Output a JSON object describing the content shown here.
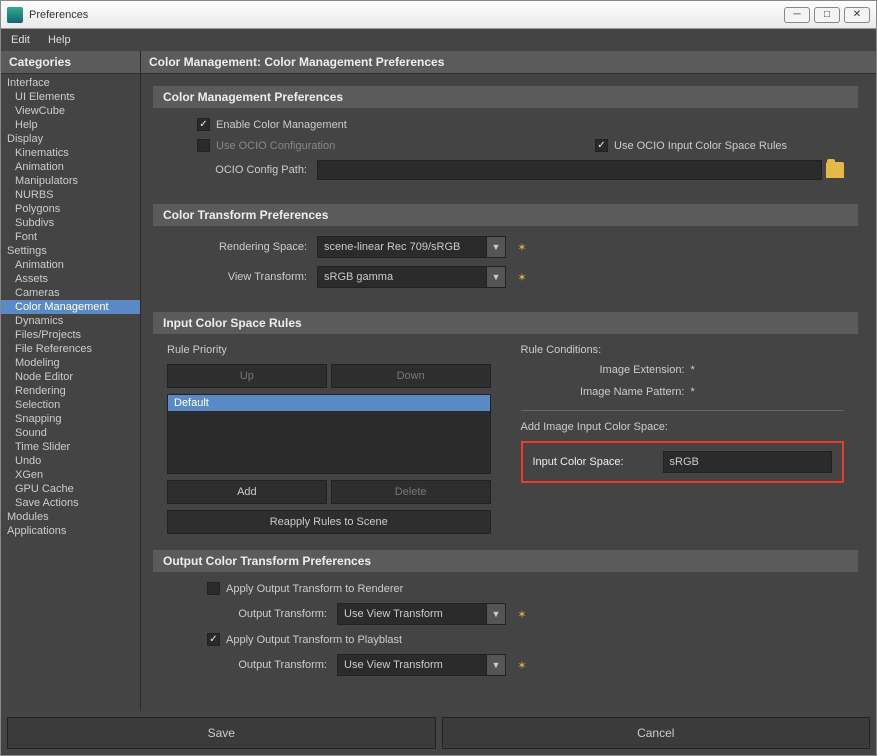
{
  "window": {
    "title": "Preferences"
  },
  "menu": {
    "edit": "Edit",
    "help": "Help"
  },
  "sidebar": {
    "header": "Categories",
    "items": [
      {
        "label": "Interface",
        "top": true
      },
      {
        "label": "UI Elements"
      },
      {
        "label": "ViewCube"
      },
      {
        "label": "Help"
      },
      {
        "label": "Display",
        "top": true
      },
      {
        "label": "Kinematics"
      },
      {
        "label": "Animation"
      },
      {
        "label": "Manipulators"
      },
      {
        "label": "NURBS"
      },
      {
        "label": "Polygons"
      },
      {
        "label": "Subdivs"
      },
      {
        "label": "Font"
      },
      {
        "label": "Settings",
        "top": true
      },
      {
        "label": "Animation"
      },
      {
        "label": "Assets"
      },
      {
        "label": "Cameras"
      },
      {
        "label": "Color Management",
        "selected": true
      },
      {
        "label": "Dynamics"
      },
      {
        "label": "Files/Projects"
      },
      {
        "label": "File References"
      },
      {
        "label": "Modeling"
      },
      {
        "label": "Node Editor"
      },
      {
        "label": "Rendering"
      },
      {
        "label": "Selection"
      },
      {
        "label": "Snapping"
      },
      {
        "label": "Sound"
      },
      {
        "label": "Time Slider"
      },
      {
        "label": "Undo"
      },
      {
        "label": "XGen"
      },
      {
        "label": "GPU Cache"
      },
      {
        "label": "Save Actions"
      },
      {
        "label": "Modules",
        "top": true
      },
      {
        "label": "Applications",
        "top": true
      }
    ]
  },
  "main": {
    "header": "Color Management: Color Management Preferences",
    "section1": {
      "title": "Color Management Preferences",
      "enable_label": "Enable Color Management",
      "use_ocio_config": "Use OCIO Configuration",
      "use_ocio_rules": "Use OCIO Input Color Space Rules",
      "ocio_path_label": "OCIO Config Path:"
    },
    "section2": {
      "title": "Color Transform Preferences",
      "rendering_label": "Rendering Space:",
      "rendering_value": "scene-linear Rec 709/sRGB",
      "view_label": "View Transform:",
      "view_value": "sRGB gamma"
    },
    "section3": {
      "title": "Input Color Space Rules",
      "rule_priority": "Rule Priority",
      "up": "Up",
      "down": "Down",
      "default_item": "Default",
      "add": "Add",
      "delete": "Delete",
      "reapply": "Reapply Rules to Scene",
      "conditions": "Rule Conditions:",
      "ext_label": "Image Extension:",
      "ext_value": "*",
      "pattern_label": "Image Name Pattern:",
      "pattern_value": "*",
      "add_space": "Add Image Input Color Space:",
      "input_cs_label": "Input Color Space:",
      "input_cs_value": "sRGB"
    },
    "section4": {
      "title": "Output Color Transform Preferences",
      "apply_renderer": "Apply Output Transform to Renderer",
      "apply_playblast": "Apply Output Transform to Playblast",
      "output_label": "Output Transform:",
      "output_value": "Use View Transform"
    }
  },
  "footer": {
    "save": "Save",
    "cancel": "Cancel"
  }
}
